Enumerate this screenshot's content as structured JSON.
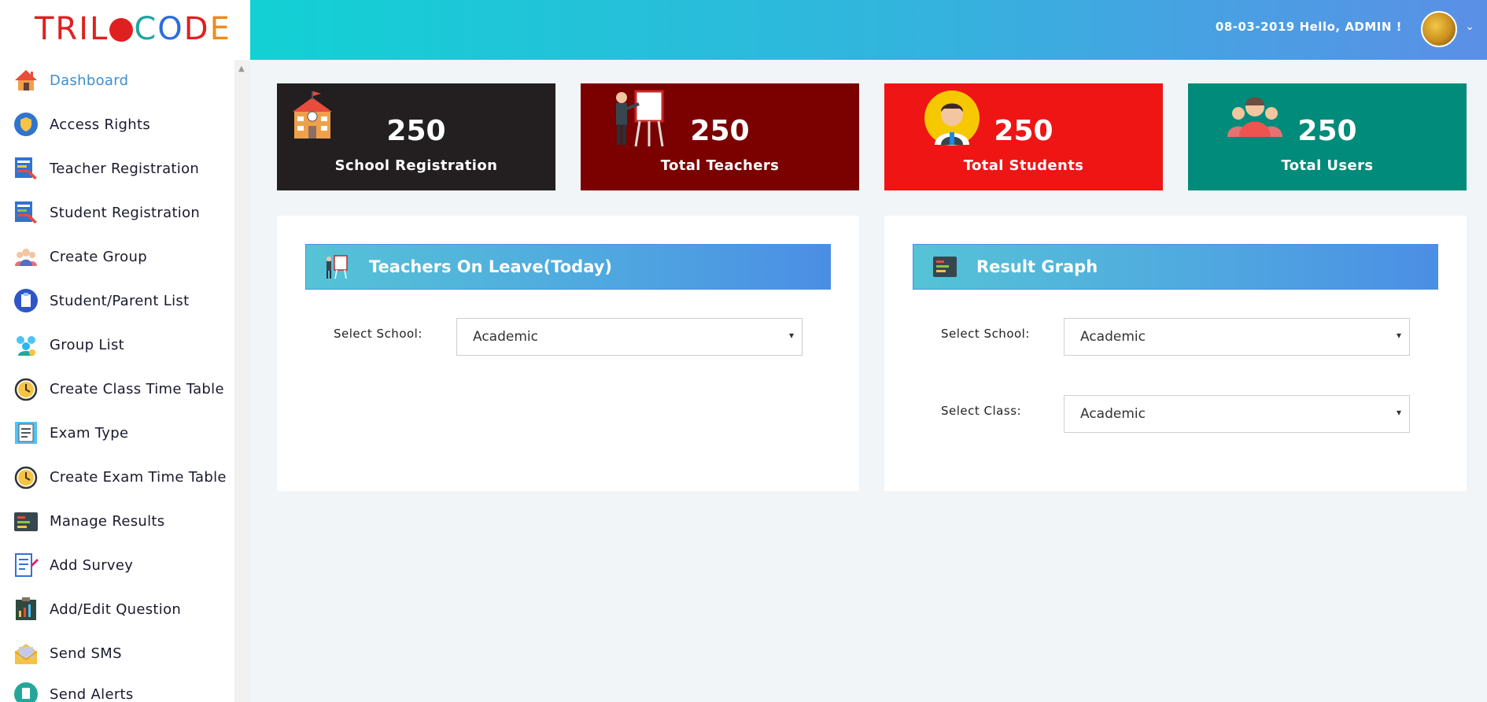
{
  "brand": {
    "logo_text": "TRILOCODE"
  },
  "header": {
    "date": "08-03-2019",
    "greeting": "Hello, ADMIN !"
  },
  "sidebar": {
    "items": [
      {
        "label": "Dashboard",
        "icon": "home-icon",
        "active": true
      },
      {
        "label": "Access Rights",
        "icon": "shield-icon"
      },
      {
        "label": "Teacher Registration",
        "icon": "teacher-board-icon"
      },
      {
        "label": "Student Registration",
        "icon": "student-board-icon"
      },
      {
        "label": "Create Group",
        "icon": "group-people-icon"
      },
      {
        "label": "Student/Parent List",
        "icon": "clipboard-icon"
      },
      {
        "label": "Group List",
        "icon": "people-list-icon"
      },
      {
        "label": "Create Class Time Table",
        "icon": "clock-icon"
      },
      {
        "label": "Exam Type",
        "icon": "document-icon"
      },
      {
        "label": "Create Exam Time Table",
        "icon": "clock-icon"
      },
      {
        "label": "Manage Results",
        "icon": "results-board-icon"
      },
      {
        "label": "Add Survey",
        "icon": "survey-pen-icon"
      },
      {
        "label": "Add/Edit Question",
        "icon": "question-board-icon"
      },
      {
        "label": "Send SMS",
        "icon": "envelope-icon"
      },
      {
        "label": "Send Alerts",
        "icon": "alert-icon"
      }
    ]
  },
  "stats": [
    {
      "value": "250",
      "label": "School Registration",
      "color": "#231f20",
      "icon": "school-building-icon"
    },
    {
      "value": "250",
      "label": "Total Teachers",
      "color": "#7b0000",
      "icon": "teacher-presenting-icon"
    },
    {
      "value": "250",
      "label": "Total Students",
      "color": "#ef1515",
      "icon": "student-avatar-icon"
    },
    {
      "value": "250",
      "label": "Total Users",
      "color": "#008b7a",
      "icon": "users-group-icon"
    }
  ],
  "panels": {
    "leave": {
      "title": "Teachers On Leave(Today)",
      "school_label": "Select School:",
      "school_value": "Academic"
    },
    "result": {
      "title": "Result Graph",
      "school_label": "Select School:",
      "school_value": "Academic",
      "class_label": "Select Class:",
      "class_value": "Academic"
    }
  }
}
